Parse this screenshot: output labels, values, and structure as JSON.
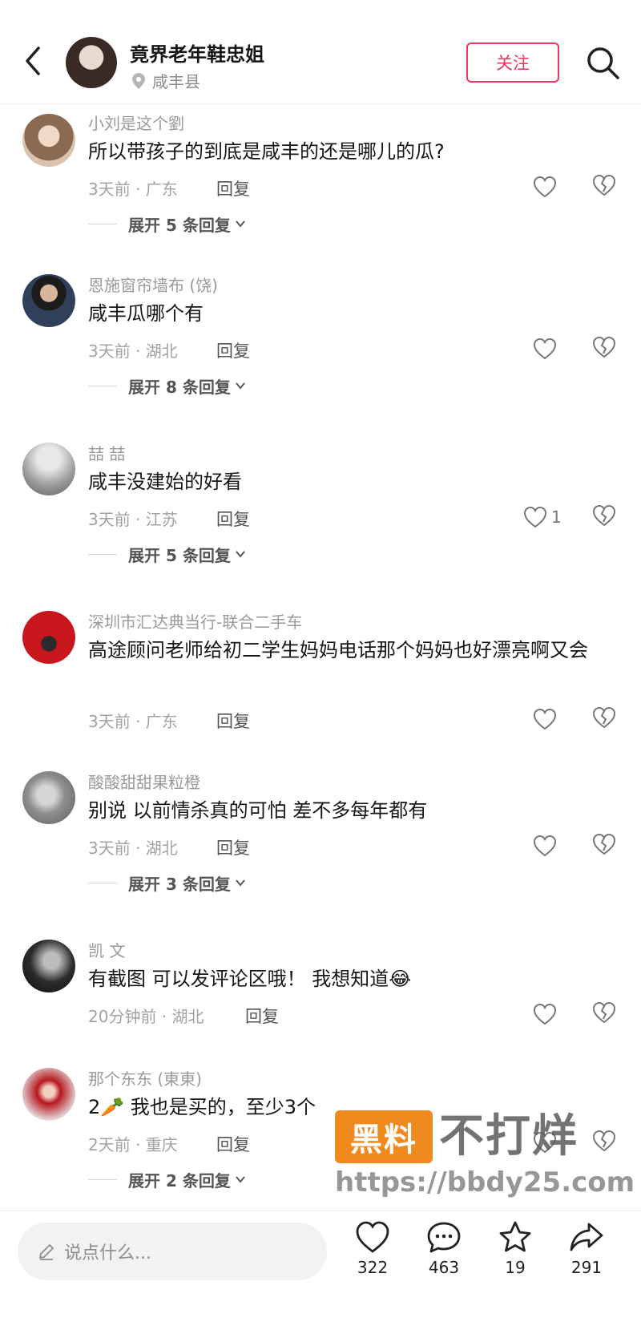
{
  "header": {
    "title": "竟界老年鞋忠姐",
    "location": "咸丰县",
    "follow_label": "关注"
  },
  "comments": [
    {
      "name": "小刘是这个劉",
      "text": "所以带孩子的到底是咸丰的还是哪儿的瓜?",
      "meta": "3天前 · 广东",
      "reply_label": "回复",
      "likes": "",
      "expand_label": "展开 5 条回复"
    },
    {
      "name": "恩施窗帘墙布 (饶)",
      "text": "咸丰瓜哪个有",
      "meta": "3天前 · 湖北",
      "reply_label": "回复",
      "likes": "",
      "expand_label": "展开 8 条回复"
    },
    {
      "name": "喆 喆",
      "text": "咸丰没建始的好看",
      "meta": "3天前 · 江苏",
      "reply_label": "回复",
      "likes": "1",
      "expand_label": "展开 5 条回复"
    },
    {
      "name": "深圳市汇达典当行-联合二手车",
      "text": "高途顾问老师给初二学生妈妈电话那个妈妈也好漂亮啊又会",
      "meta": "3天前 · 广东",
      "reply_label": "回复",
      "likes": "",
      "expand_label": ""
    },
    {
      "name": "酸酸甜甜果粒橙",
      "text": "别说 以前情杀真的可怕 差不多每年都有",
      "meta": "3天前 · 湖北",
      "reply_label": "回复",
      "likes": "",
      "expand_label": "展开 3 条回复"
    },
    {
      "name": "凯 文",
      "text": "有截图 可以发评论区哦！ 我想知道😂",
      "meta": "20分钟前 · 湖北",
      "reply_label": "回复",
      "likes": "",
      "expand_label": ""
    },
    {
      "name": "那个东东 (東東)",
      "text": "2🥕 我也是买的，至少3个",
      "meta": "2天前 · 重庆",
      "reply_label": "回复",
      "likes": "",
      "expand_label": "展开 2 条回复"
    }
  ],
  "watermark": {
    "badge": "黑料",
    "main": "不打烊",
    "url": "https://bbdy25.com"
  },
  "bottom": {
    "input_placeholder": "说点什么...",
    "likes": "322",
    "comments": "463",
    "favorites": "19",
    "shares": "291"
  },
  "colors": {
    "accent": "#e8365d",
    "watermark_orange": "#f08a1e"
  }
}
